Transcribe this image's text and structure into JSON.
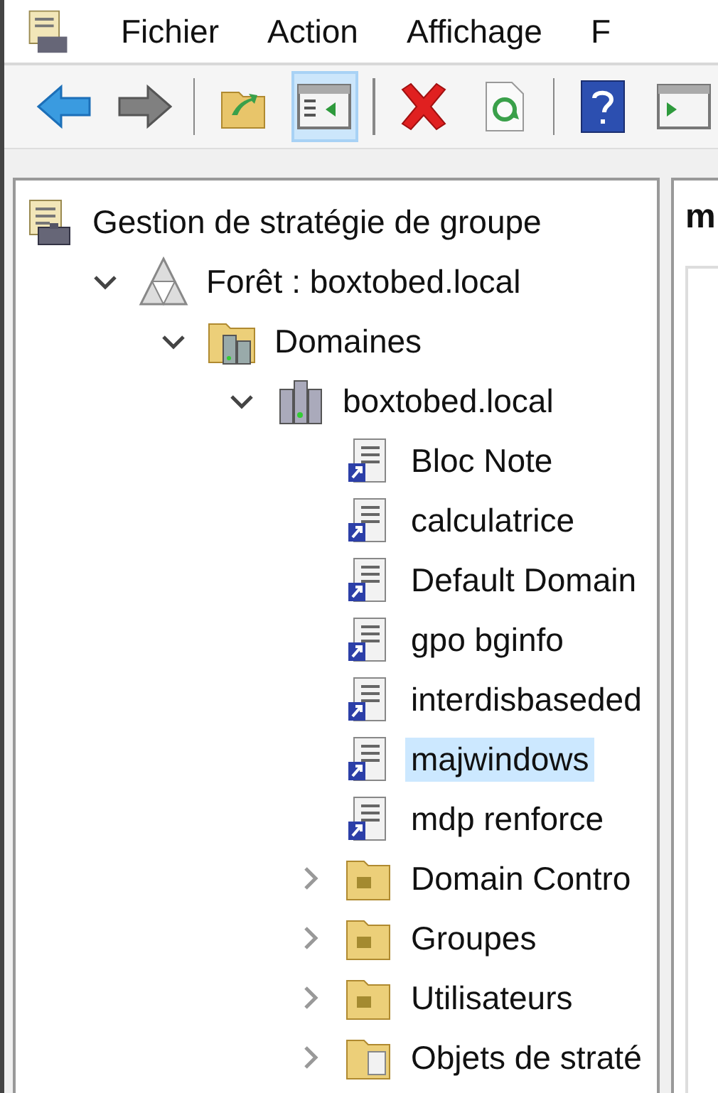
{
  "menu": [
    {
      "label": "Fichier"
    },
    {
      "label": "Action"
    },
    {
      "label": "Affichage"
    },
    {
      "label": "F"
    }
  ],
  "toolbar": [
    {
      "kind": "back",
      "selected": false
    },
    {
      "kind": "forward",
      "selected": false
    },
    {
      "kind": "sep"
    },
    {
      "kind": "up",
      "selected": false
    },
    {
      "kind": "panel",
      "selected": true
    },
    {
      "kind": "sep"
    },
    {
      "kind": "delete",
      "selected": false
    },
    {
      "kind": "refresh",
      "selected": false
    },
    {
      "kind": "sep"
    },
    {
      "kind": "help",
      "selected": false
    },
    {
      "kind": "panel2",
      "selected": false
    }
  ],
  "tree": [
    {
      "kind": "console",
      "label": "Gestion de stratégie de groupe",
      "selected": false,
      "children": [
        {
          "kind": "forest",
          "label": "Forêt : boxtobed.local",
          "expanded": true,
          "selected": false,
          "children": [
            {
              "kind": "domains",
              "label": "Domaines",
              "expanded": true,
              "selected": false,
              "children": [
                {
                  "kind": "domain",
                  "label": "boxtobed.local",
                  "expanded": true,
                  "selected": false,
                  "children": [
                    {
                      "kind": "gpo",
                      "label": "Bloc Note",
                      "selected": false
                    },
                    {
                      "kind": "gpo",
                      "label": "calculatrice",
                      "selected": false
                    },
                    {
                      "kind": "gpo",
                      "label": "Default Domain",
                      "selected": false
                    },
                    {
                      "kind": "gpo",
                      "label": "gpo bginfo",
                      "selected": false
                    },
                    {
                      "kind": "gpo",
                      "label": "interdisbaseded",
                      "selected": false
                    },
                    {
                      "kind": "gpo",
                      "label": "majwindows",
                      "selected": true
                    },
                    {
                      "kind": "gpo",
                      "label": "mdp renforce",
                      "selected": false
                    },
                    {
                      "kind": "folder",
                      "label": "Domain Contro",
                      "expanded": false,
                      "selected": false
                    },
                    {
                      "kind": "folder",
                      "label": "Groupes",
                      "expanded": false,
                      "selected": false
                    },
                    {
                      "kind": "folder",
                      "label": "Utilisateurs",
                      "expanded": false,
                      "selected": false
                    },
                    {
                      "kind": "gpofolder",
                      "label": "Objets de straté",
                      "expanded": false,
                      "selected": false
                    }
                  ]
                }
              ]
            }
          ]
        }
      ]
    }
  ],
  "right_panel": {
    "title": "m"
  }
}
